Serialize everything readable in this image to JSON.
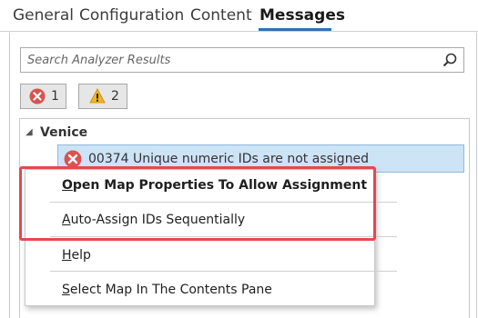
{
  "tabs": [
    {
      "label": "General"
    },
    {
      "label": "Configuration"
    },
    {
      "label": "Content"
    },
    {
      "label": "Messages",
      "active": true
    }
  ],
  "search": {
    "placeholder": "Search Analyzer Results"
  },
  "filters": {
    "errors": {
      "count": "1",
      "icon": "error-icon"
    },
    "warnings": {
      "count": "2",
      "icon": "warning-icon"
    }
  },
  "tree": {
    "group": "Venice",
    "message": {
      "code": "00374",
      "text": "Unique numeric IDs are not assigned",
      "icon": "error-icon"
    }
  },
  "context_menu": {
    "items": [
      {
        "first": "O",
        "rest": "pen Map Properties To Allow Assignment"
      },
      {
        "first": "A",
        "rest": "uto-Assign IDs Sequentially"
      },
      {
        "first": "H",
        "rest": "elp"
      },
      {
        "first": "S",
        "rest": "elect Map In The Contents Pane"
      }
    ]
  },
  "colors": {
    "accent": "#2f6fb6",
    "error": "#d9534f",
    "warning": "#f0b429",
    "highlight": "#e5484d",
    "selection": "#cde3f6"
  }
}
